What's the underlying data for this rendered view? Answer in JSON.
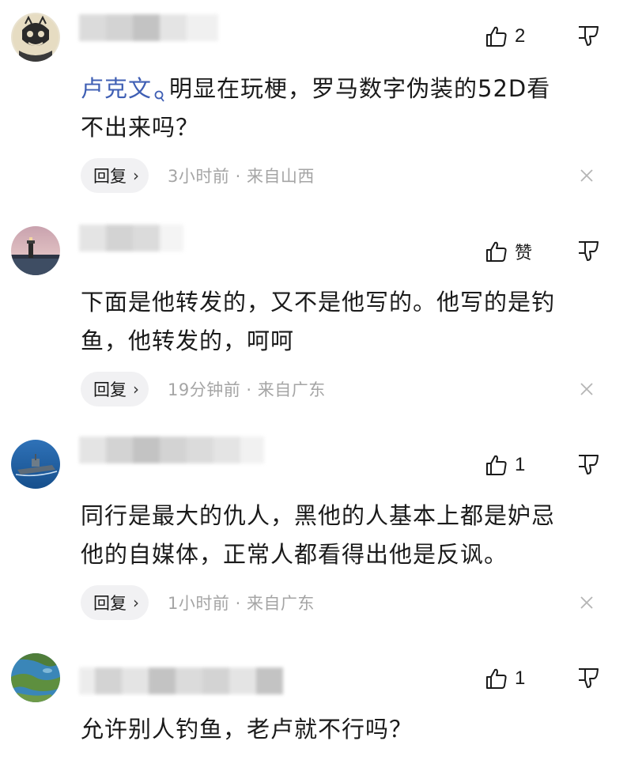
{
  "comments": [
    {
      "like_count": "2",
      "mention": "卢克文",
      "text": "明显在玩梗，罗马数字伪装的52D看",
      "text2": "不出来吗？",
      "reply_label": "回复",
      "time": "3小时前",
      "separator": "·",
      "location": "来自山西"
    },
    {
      "like_count": "赞",
      "text": "下面是他转发的，又不是他写的。他写的是钓",
      "text2": "鱼，他转发的，呵呵",
      "reply_label": "回复",
      "time": "19分钟前",
      "separator": "·",
      "location": "来自广东"
    },
    {
      "like_count": "1",
      "text": "同行是最大的仇人，黑他的人基本上都是妒忌",
      "text2": "他的自媒体，正常人都看得出他是反讽。",
      "reply_label": "回复",
      "time": "1小时前",
      "separator": "·",
      "location": "来自广东"
    },
    {
      "like_count": "1",
      "text": "允许别人钓鱼，老卢就不行吗？"
    }
  ],
  "icons": {
    "like": "thumbs-up-icon",
    "dislike": "thumbs-down-icon",
    "close": "close-icon",
    "search": "search-icon",
    "chevron": "chevron-right-icon"
  },
  "colors": {
    "mention": "#3f5fb4",
    "meta_text": "#a5a5a5",
    "reply_bg": "#f1f1f3"
  }
}
